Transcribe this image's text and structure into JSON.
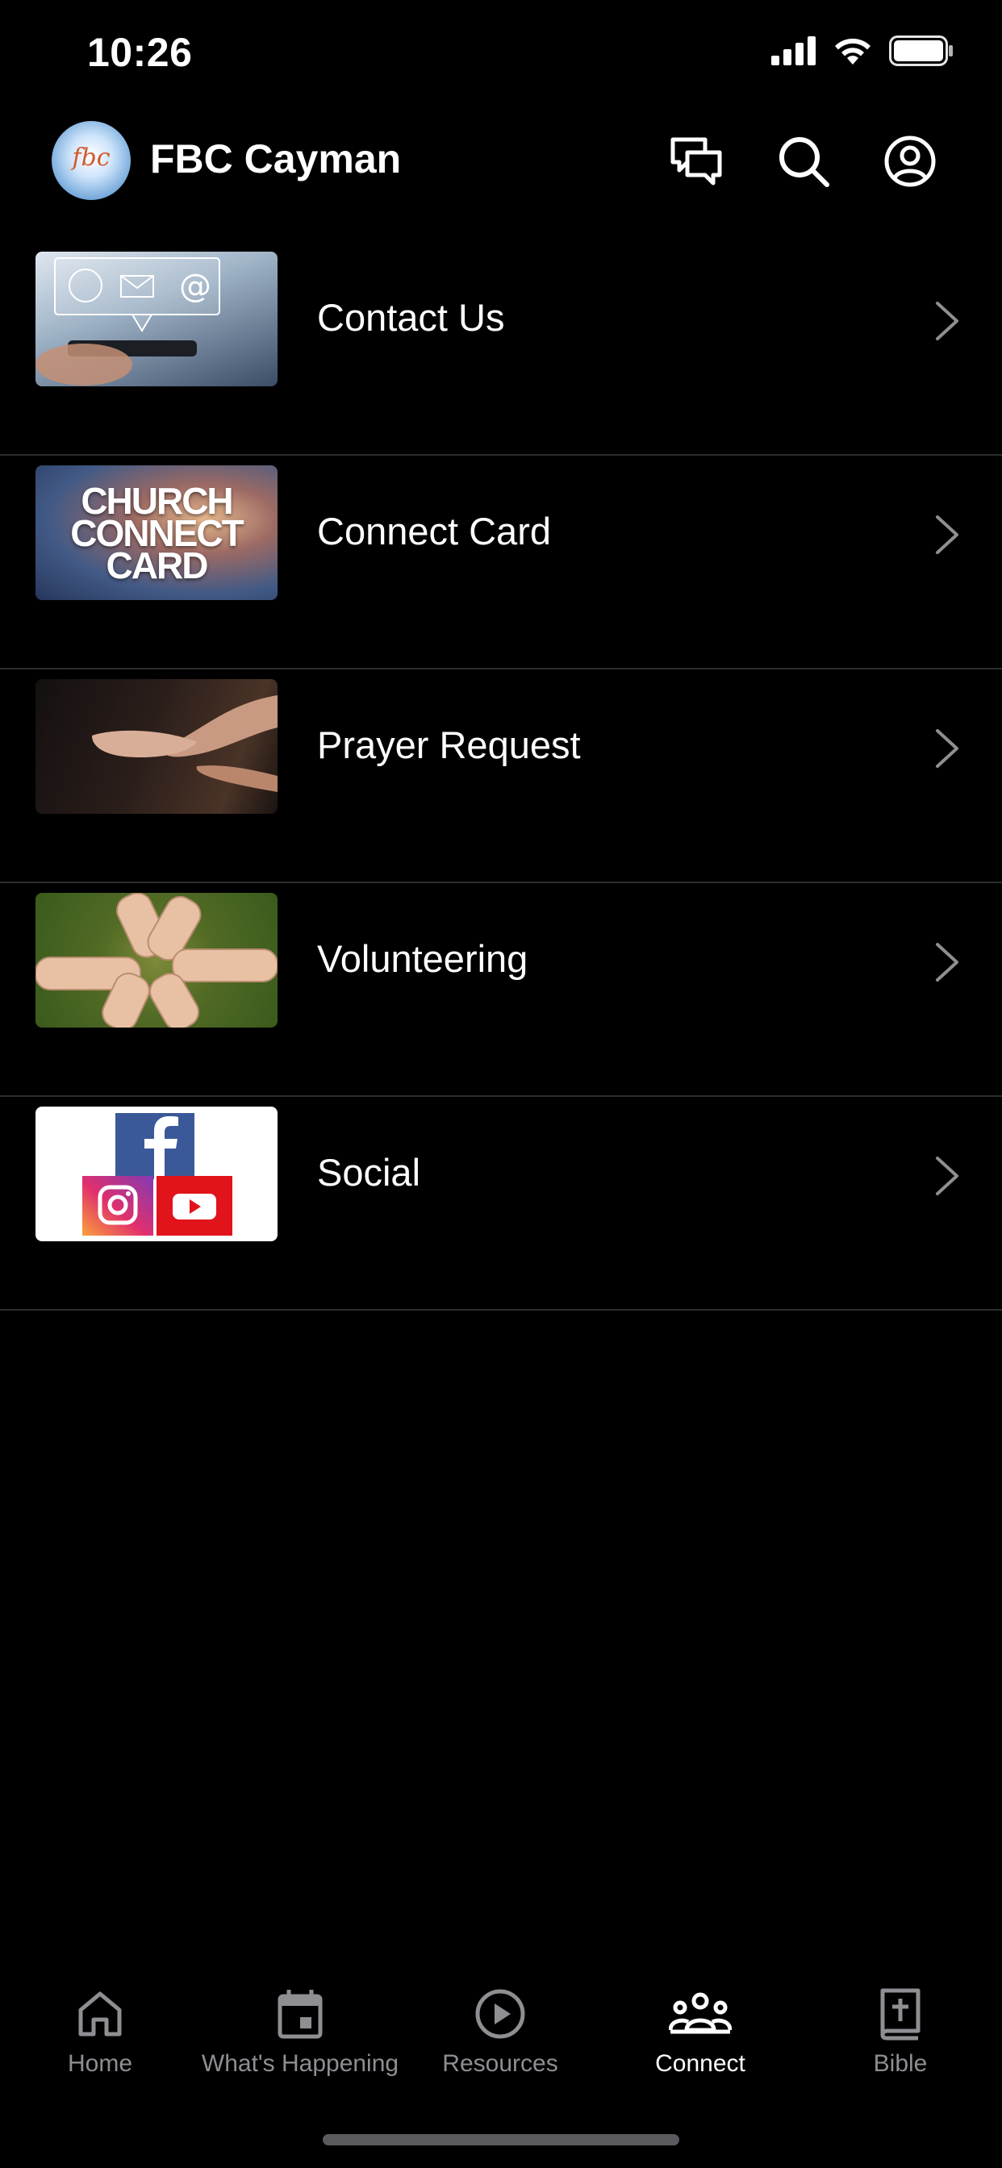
{
  "status_bar": {
    "time": "10:26"
  },
  "header": {
    "title": "FBC Cayman",
    "logo_text": "fbc"
  },
  "list": {
    "items": [
      {
        "label": "Contact Us"
      },
      {
        "label": "Connect Card",
        "thumb_text": [
          "CHURCH",
          "CONNECT",
          "CARD"
        ]
      },
      {
        "label": "Prayer Request"
      },
      {
        "label": "Volunteering"
      },
      {
        "label": "Social"
      }
    ]
  },
  "tabs": [
    {
      "label": "Home",
      "icon": "home-icon"
    },
    {
      "label": "What's Happening",
      "icon": "calendar-icon"
    },
    {
      "label": "Resources",
      "icon": "play-circle-icon"
    },
    {
      "label": "Connect",
      "icon": "people-icon",
      "active": true
    },
    {
      "label": "Bible",
      "icon": "bible-icon"
    }
  ],
  "colors": {
    "background": "#000000",
    "text": "#ffffff",
    "inactive_tab": "#8e8e93",
    "divider": "#2c2c2e"
  }
}
